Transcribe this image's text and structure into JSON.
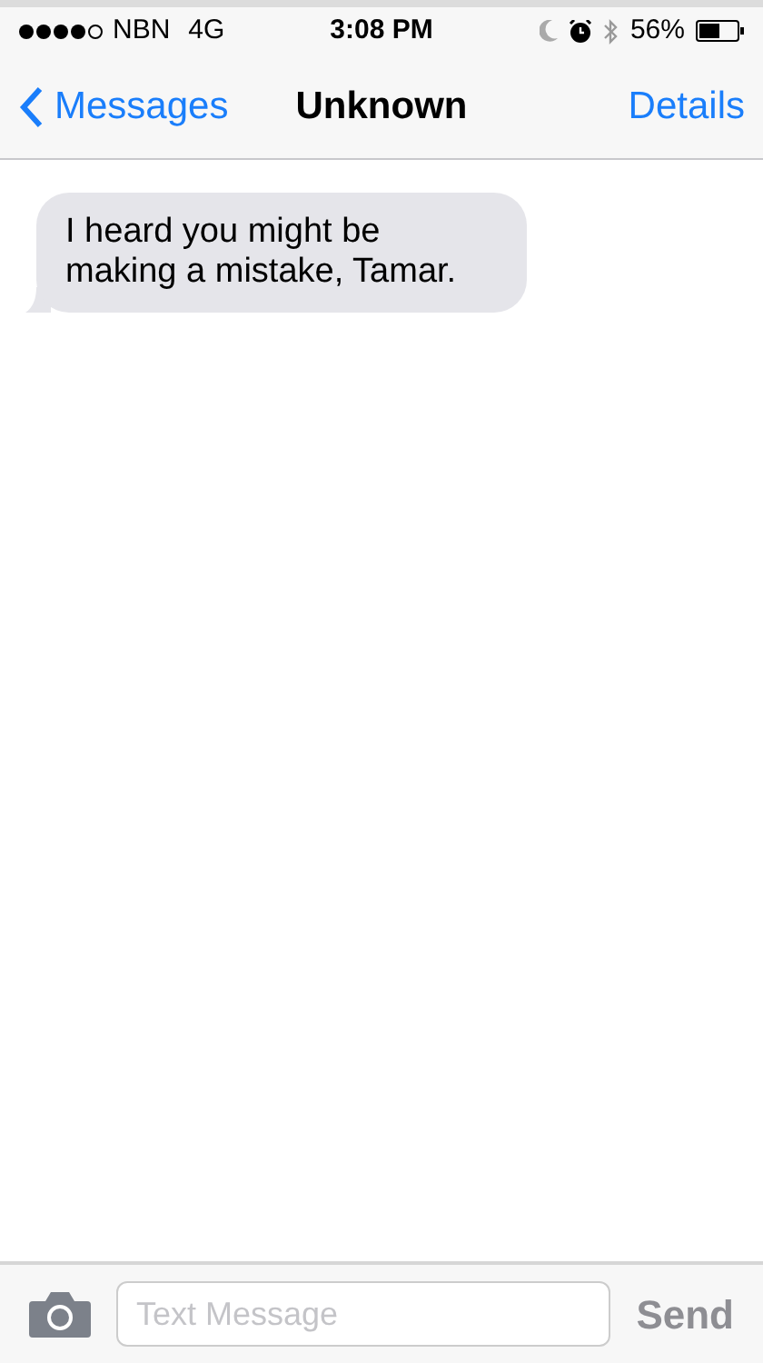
{
  "status_bar": {
    "carrier": "NBN",
    "network": "4G",
    "time": "3:08 PM",
    "battery": "56%"
  },
  "nav": {
    "back": "Messages",
    "title": "Unknown",
    "action": "Details"
  },
  "messages": [
    {
      "text": "I heard you might be making a mistake, Tamar.",
      "kind": "incoming"
    }
  ],
  "composer": {
    "placeholder": "Text Message",
    "send": {
      "label": "Send",
      "disabled": true
    }
  }
}
